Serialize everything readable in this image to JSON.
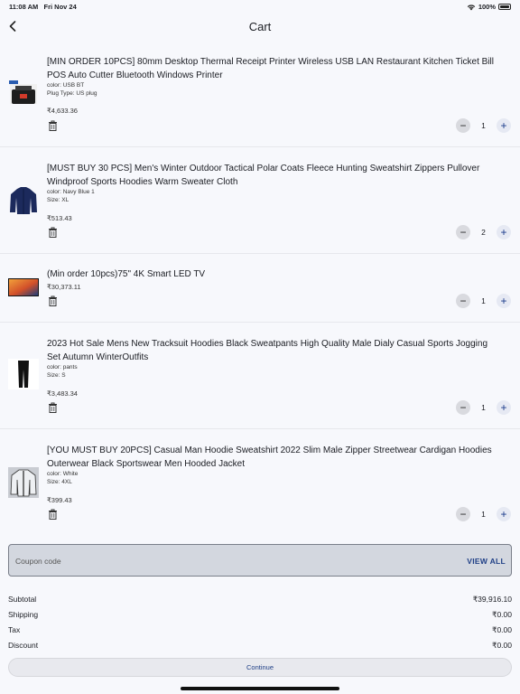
{
  "status": {
    "time": "11:08 AM",
    "date": "Fri Nov 24",
    "battery": "100%"
  },
  "header": {
    "title": "Cart"
  },
  "items": [
    {
      "name": "[MIN ORDER 10PCS]  80mm Desktop Thermal Receipt Printer Wireless USB LAN Restaurant Kitchen Ticket Bill POS Auto Cutter Bluetooth Windows Printer",
      "variants": [
        "color: USB BT",
        "Plug Type: US plug"
      ],
      "price": "₹4,633.36",
      "quantity": "1"
    },
    {
      "name": "[MUST BUY 30 PCS] Men's Winter Outdoor Tactical Polar Coats Fleece Hunting Sweatshirt Zippers Pullover Windproof Sports Hoodies Warm Sweater Cloth",
      "variants": [
        "color: Navy Blue 1",
        "Size: XL"
      ],
      "price": "₹513.43",
      "quantity": "2"
    },
    {
      "name": "(Min order 10pcs)75\" 4K Smart LED TV",
      "variants": [],
      "price": "₹30,373.11",
      "quantity": "1"
    },
    {
      "name": "2023 Hot Sale Mens New Tracksuit Hoodies Black Sweatpants High Quality Male Dialy Casual Sports Jogging Set Autumn WinterOutfits",
      "variants": [
        "color: pants",
        "Size: S"
      ],
      "price": "₹3,483.34",
      "quantity": "1"
    },
    {
      "name": "[YOU MUST BUY 20PCS]  Casual Man Hoodie Sweatshirt 2022 Slim Male Zipper Streetwear Cardigan Hoodies Outerwear Black Sportswear Men Hooded Jacket",
      "variants": [
        "color: White",
        "Size: 4XL"
      ],
      "price": "₹399.43",
      "quantity": "1"
    }
  ],
  "coupon": {
    "placeholder": "Coupon code",
    "view_all": "VIEW ALL"
  },
  "summary": {
    "subtotal_label": "Subtotal",
    "subtotal": "₹39,916.10",
    "shipping_label": "Shipping",
    "shipping": "₹0.00",
    "tax_label": "Tax",
    "tax": "₹0.00",
    "discount_label": "Discount",
    "discount": "₹0.00"
  },
  "continue_label": "Continue",
  "colors": {
    "accent": "#1f3f86",
    "background": "#f7f8fc",
    "coupon_bg": "#d3d7df"
  },
  "icons": [
    "back-chevron-icon",
    "wifi-icon",
    "battery-icon",
    "trash-icon",
    "minus-icon",
    "plus-icon"
  ]
}
